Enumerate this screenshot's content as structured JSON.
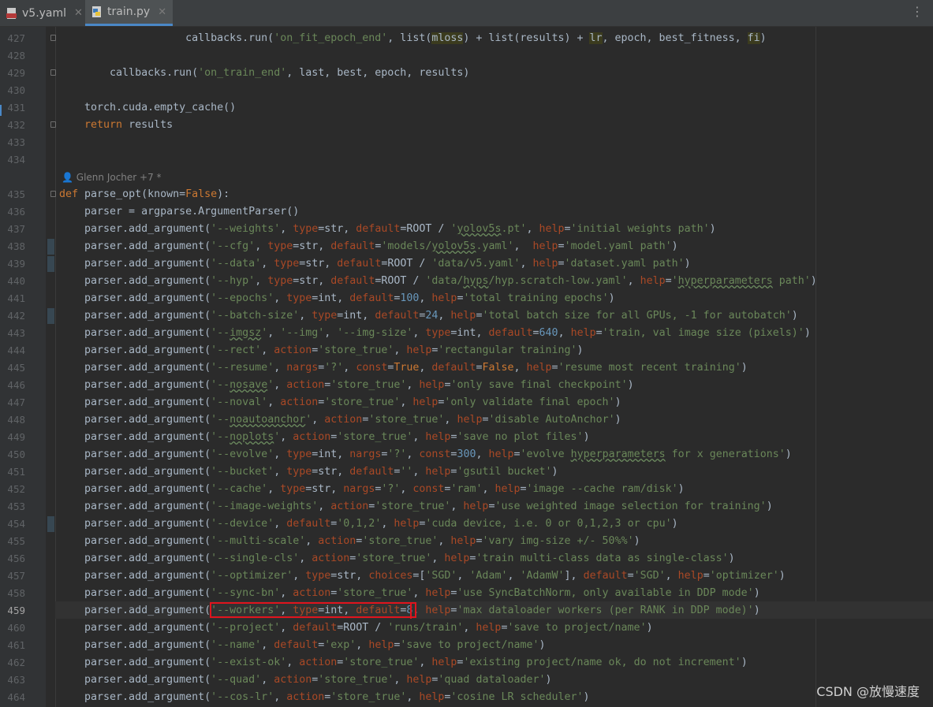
{
  "tabs": [
    {
      "label": "v5.yaml",
      "icon": "yaml-file-icon",
      "active": false
    },
    {
      "label": "train.py",
      "icon": "python-file-icon",
      "active": true
    }
  ],
  "author_hint": "Glenn Jocher +7 *",
  "watermark": "CSDN @放慢速度",
  "current_line": "459",
  "lines": [
    {
      "n": "427",
      "html": "                    callbacks.run(<span class=\"st\">'on_fit_epoch_end'</span>, list(<span class=\"hl\">mloss</span>) + list(results) + <span class=\"hl\">lr</span>, epoch, best_fitness, <span class=\"hl\">fi</span>)"
    },
    {
      "n": "428",
      "html": ""
    },
    {
      "n": "429",
      "html": "        callbacks.run(<span class=\"st\">'on_train_end'</span>, last, best, epoch, results)"
    },
    {
      "n": "430",
      "html": ""
    },
    {
      "n": "431",
      "html": "    torch.cuda.empty_cache()"
    },
    {
      "n": "432",
      "html": "    <span class=\"kw\">return</span> results"
    },
    {
      "n": "433",
      "html": ""
    },
    {
      "n": "434",
      "html": ""
    },
    {
      "n": "435",
      "html": "<span class=\"kw\">def</span> parse_opt(known=<span class=\"kw\">False</span>):"
    },
    {
      "n": "436",
      "html": "    parser = argparse.ArgumentParser()"
    },
    {
      "n": "437",
      "html": "    parser.add_argument(<span class=\"st\">'--weights'</span>, <span class=\"kwarg\">type</span>=str, <span class=\"kwarg\">default</span>=ROOT / <span class=\"st\">'<span class=\"under\">yolov5s</span>.pt'</span>, <span class=\"kwarg\">help</span>=<span class=\"st\">'initial weights path'</span>)"
    },
    {
      "n": "438",
      "html": "    parser.add_argument(<span class=\"st\">'--cfg'</span>, <span class=\"kwarg\">type</span>=str, <span class=\"kwarg\">default</span>=<span class=\"st\">'models/<span class=\"under\">yolov5s</span>.yaml'</span>,  <span class=\"kwarg\">help</span>=<span class=\"st\">'model.yaml path'</span>)"
    },
    {
      "n": "439",
      "html": "    parser.add_argument(<span class=\"st\">'--data'</span>, <span class=\"kwarg\">type</span>=str, <span class=\"kwarg\">default</span>=ROOT / <span class=\"st\">'data/v5.yaml'</span>, <span class=\"kwarg\">help</span>=<span class=\"st\">'dataset.yaml path'</span>)"
    },
    {
      "n": "440",
      "html": "    parser.add_argument(<span class=\"st\">'--hyp'</span>, <span class=\"kwarg\">type</span>=str, <span class=\"kwarg\">default</span>=ROOT / <span class=\"st\">'data/<span class=\"under\">hyps</span>/hyp.scratch-low.yaml'</span>, <span class=\"kwarg\">help</span>=<span class=\"st\">'<span class=\"under\">hyperparameters</span> path'</span>)"
    },
    {
      "n": "441",
      "html": "    parser.add_argument(<span class=\"st\">'--epochs'</span>, <span class=\"kwarg\">type</span>=int, <span class=\"kwarg\">default</span>=<span class=\"nm\">100</span>, <span class=\"kwarg\">help</span>=<span class=\"st\">'total training epochs'</span>)"
    },
    {
      "n": "442",
      "html": "    parser.add_argument(<span class=\"st\">'--batch-size'</span>, <span class=\"kwarg\">type</span>=int, <span class=\"kwarg\">default</span>=<span class=\"nm\">24</span>, <span class=\"kwarg\">help</span>=<span class=\"st\">'total batch size for all GPUs, -1 for autobatch'</span>)"
    },
    {
      "n": "443",
      "html": "    parser.add_argument(<span class=\"st\">'--<span class=\"under\">imgsz</span>'</span>, <span class=\"st\">'--img'</span>, <span class=\"st\">'--img-size'</span>, <span class=\"kwarg\">type</span>=int, <span class=\"kwarg\">default</span>=<span class=\"nm\">640</span>, <span class=\"kwarg\">help</span>=<span class=\"st\">'train, val image size (pixels)'</span>)"
    },
    {
      "n": "444",
      "html": "    parser.add_argument(<span class=\"st\">'--rect'</span>, <span class=\"kwarg\">action</span>=<span class=\"st\">'store_true'</span>, <span class=\"kwarg\">help</span>=<span class=\"st\">'rectangular training'</span>)"
    },
    {
      "n": "445",
      "html": "    parser.add_argument(<span class=\"st\">'--resume'</span>, <span class=\"kwarg\">nargs</span>=<span class=\"st\">'?'</span>, <span class=\"kwarg\">const</span>=<span class=\"kw\">True</span>, <span class=\"kwarg\">default</span>=<span class=\"kw\">False</span>, <span class=\"kwarg\">help</span>=<span class=\"st\">'resume most recent training'</span>)"
    },
    {
      "n": "446",
      "html": "    parser.add_argument(<span class=\"st\">'--<span class=\"under\">nosave</span>'</span>, <span class=\"kwarg\">action</span>=<span class=\"st\">'store_true'</span>, <span class=\"kwarg\">help</span>=<span class=\"st\">'only save final checkpoint'</span>)"
    },
    {
      "n": "447",
      "html": "    parser.add_argument(<span class=\"st\">'--noval'</span>, <span class=\"kwarg\">action</span>=<span class=\"st\">'store_true'</span>, <span class=\"kwarg\">help</span>=<span class=\"st\">'only validate final epoch'</span>)"
    },
    {
      "n": "448",
      "html": "    parser.add_argument(<span class=\"st\">'--<span class=\"under\">noautoanchor</span>'</span>, <span class=\"kwarg\">action</span>=<span class=\"st\">'store_true'</span>, <span class=\"kwarg\">help</span>=<span class=\"st\">'disable AutoAnchor'</span>)"
    },
    {
      "n": "449",
      "html": "    parser.add_argument(<span class=\"st\">'--<span class=\"under\">noplots</span>'</span>, <span class=\"kwarg\">action</span>=<span class=\"st\">'store_true'</span>, <span class=\"kwarg\">help</span>=<span class=\"st\">'save no plot files'</span>)"
    },
    {
      "n": "450",
      "html": "    parser.add_argument(<span class=\"st\">'--evolve'</span>, <span class=\"kwarg\">type</span>=int, <span class=\"kwarg\">nargs</span>=<span class=\"st\">'?'</span>, <span class=\"kwarg\">const</span>=<span class=\"nm\">300</span>, <span class=\"kwarg\">help</span>=<span class=\"st\">'evolve <span class=\"under\">hyperparameters</span> for x generations'</span>)"
    },
    {
      "n": "451",
      "html": "    parser.add_argument(<span class=\"st\">'--bucket'</span>, <span class=\"kwarg\">type</span>=str, <span class=\"kwarg\">default</span>=<span class=\"st\">''</span>, <span class=\"kwarg\">help</span>=<span class=\"st\">'gsutil bucket'</span>)"
    },
    {
      "n": "452",
      "html": "    parser.add_argument(<span class=\"st\">'--cache'</span>, <span class=\"kwarg\">type</span>=str, <span class=\"kwarg\">nargs</span>=<span class=\"st\">'?'</span>, <span class=\"kwarg\">const</span>=<span class=\"st\">'ram'</span>, <span class=\"kwarg\">help</span>=<span class=\"st\">'image --cache ram/disk'</span>)"
    },
    {
      "n": "453",
      "html": "    parser.add_argument(<span class=\"st\">'--image-weights'</span>, <span class=\"kwarg\">action</span>=<span class=\"st\">'store_true'</span>, <span class=\"kwarg\">help</span>=<span class=\"st\">'use weighted image selection for training'</span>)"
    },
    {
      "n": "454",
      "html": "    parser.add_argument(<span class=\"st\">'--device'</span>, <span class=\"kwarg\">default</span>=<span class=\"st\">'0,1,2'</span>, <span class=\"kwarg\">help</span>=<span class=\"st\">'cuda device, i.e. 0 or 0,1,2,3 or cpu'</span>)"
    },
    {
      "n": "455",
      "html": "    parser.add_argument(<span class=\"st\">'--multi-scale'</span>, <span class=\"kwarg\">action</span>=<span class=\"st\">'store_true'</span>, <span class=\"kwarg\">help</span>=<span class=\"st\">'vary img-size +/- 50%%'</span>)"
    },
    {
      "n": "456",
      "html": "    parser.add_argument(<span class=\"st\">'--single-cls'</span>, <span class=\"kwarg\">action</span>=<span class=\"st\">'store_true'</span>, <span class=\"kwarg\">help</span>=<span class=\"st\">'train multi-class data as single-class'</span>)"
    },
    {
      "n": "457",
      "html": "    parser.add_argument(<span class=\"st\">'--optimizer'</span>, <span class=\"kwarg\">type</span>=str, <span class=\"kwarg\">choices</span>=[<span class=\"st\">'SGD'</span>, <span class=\"st\">'Adam'</span>, <span class=\"st\">'AdamW'</span>], <span class=\"kwarg\">default</span>=<span class=\"st\">'SGD'</span>, <span class=\"kwarg\">help</span>=<span class=\"st\">'optimizer'</span>)"
    },
    {
      "n": "458",
      "html": "    parser.add_argument(<span class=\"st\">'--sync-bn'</span>, <span class=\"kwarg\">action</span>=<span class=\"st\">'store_true'</span>, <span class=\"kwarg\">help</span>=<span class=\"st\">'use SyncBatchNorm, only available in DDP mode'</span>)"
    },
    {
      "n": "459",
      "html": "    parser.add_argument(<span class=\"st\">'--workers'</span>, <span class=\"kwarg\">type</span>=int, <span class=\"kwarg\">default</span>=<span class=\"nm\">8</span>, <span class=\"kwarg\">help</span>=<span class=\"st\">'max dataloader workers (per RANK in DDP mode)'</span>)"
    },
    {
      "n": "460",
      "html": "    parser.add_argument(<span class=\"st\">'--project'</span>, <span class=\"kwarg\">default</span>=ROOT / <span class=\"st\">'runs/train'</span>, <span class=\"kwarg\">help</span>=<span class=\"st\">'save to project/name'</span>)"
    },
    {
      "n": "461",
      "html": "    parser.add_argument(<span class=\"st\">'--name'</span>, <span class=\"kwarg\">default</span>=<span class=\"st\">'exp'</span>, <span class=\"kwarg\">help</span>=<span class=\"st\">'save to project/name'</span>)"
    },
    {
      "n": "462",
      "html": "    parser.add_argument(<span class=\"st\">'--exist-ok'</span>, <span class=\"kwarg\">action</span>=<span class=\"st\">'store_true'</span>, <span class=\"kwarg\">help</span>=<span class=\"st\">'existing project/name ok, do not increment'</span>)"
    },
    {
      "n": "463",
      "html": "    parser.add_argument(<span class=\"st\">'--quad'</span>, <span class=\"kwarg\">action</span>=<span class=\"st\">'store_true'</span>, <span class=\"kwarg\">help</span>=<span class=\"st\">'quad dataloader'</span>)"
    },
    {
      "n": "464",
      "html": "    parser.add_argument(<span class=\"st\">'--cos-lr'</span>, <span class=\"kwarg\">action</span>=<span class=\"st\">'store_true'</span>, <span class=\"kwarg\">help</span>=<span class=\"st\">'cosine LR scheduler'</span>)"
    }
  ]
}
